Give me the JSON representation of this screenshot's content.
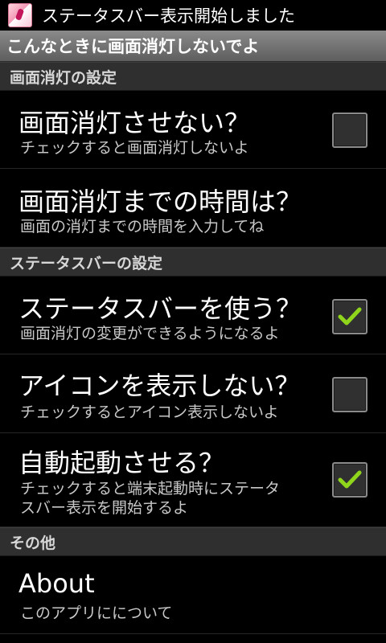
{
  "statusbar": {
    "notification_text": "ステータスバー表示開始しました"
  },
  "app": {
    "title": "こんなときに画面消灯しないでよ"
  },
  "sections": {
    "screen": {
      "header": "画面消灯の設定"
    },
    "statusbar": {
      "header": "ステータスバーの設定"
    },
    "other": {
      "header": "その他"
    }
  },
  "prefs": {
    "no_screen_off": {
      "title": "画面消灯させない？",
      "summary": "チェックすると画面消灯しないよ",
      "checked": false
    },
    "time_until_off": {
      "title": "画面消灯までの時間は？",
      "summary": "画面の消灯までの時間を入力してね"
    },
    "use_statusbar": {
      "title": "ステータスバーを使う？",
      "summary": "画面消灯の変更ができるようになるよ",
      "checked": true
    },
    "hide_icon": {
      "title": "アイコンを表示しない？",
      "summary": "チェックするとアイコン表示しないよ",
      "checked": false
    },
    "auto_start": {
      "title": "自動起動させる？",
      "summary_line1": "チェックすると端末起動時にステータ",
      "summary_line2": "スバー表示を開始するよ",
      "checked": true
    },
    "about": {
      "title": "About",
      "summary": "このアプリにについて"
    }
  },
  "colors": {
    "check_green": "#8ed51c",
    "background": "#000000",
    "titlebar": "#6f6f6f",
    "section_header": "#2f2f2f"
  }
}
